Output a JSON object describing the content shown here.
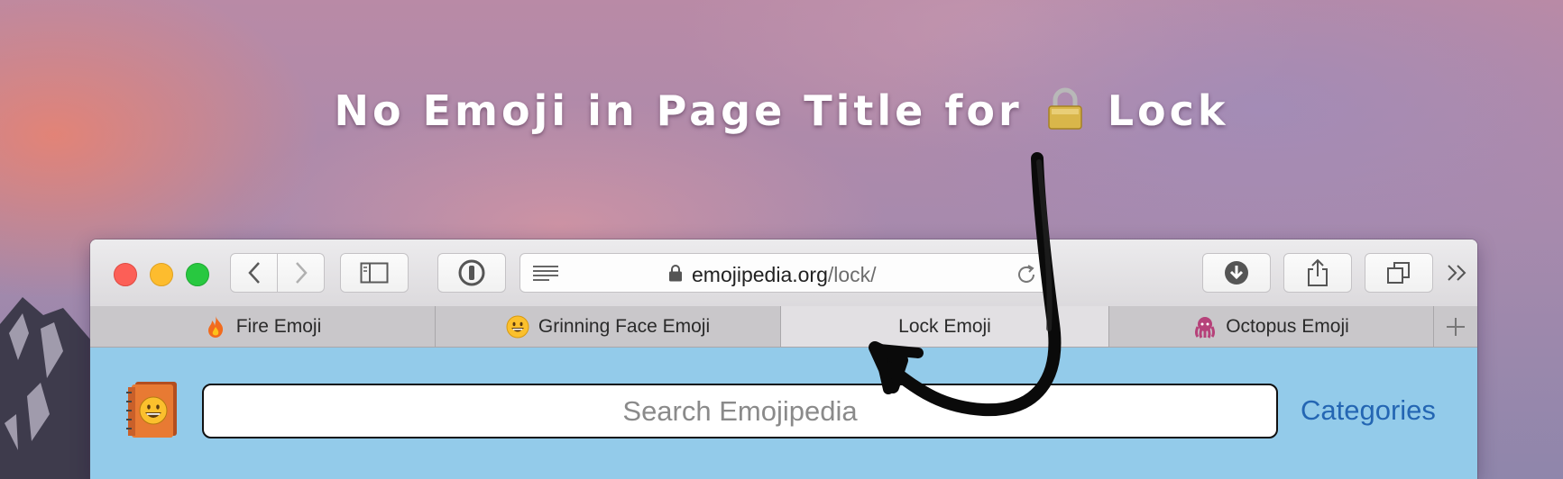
{
  "headline": {
    "before": "No Emoji in Page Title for",
    "after": "Lock"
  },
  "browser": {
    "address_bar": {
      "domain": "emojipedia.org",
      "path": "/lock/"
    },
    "tabs": [
      {
        "label": "Fire Emoji",
        "icon": "fire-icon"
      },
      {
        "label": "Grinning Face Emoji",
        "icon": "grinning-face-icon"
      },
      {
        "label": "Lock Emoji",
        "icon": "",
        "active": true
      },
      {
        "label": "Octopus Emoji",
        "icon": "octopus-icon"
      }
    ]
  },
  "site": {
    "search_placeholder": "Search Emojipedia",
    "categories_label": "Categories"
  },
  "colors": {
    "close": "#fc5f57",
    "minimize": "#fdbc2e",
    "zoom": "#28c840",
    "site_background": "#93cbea",
    "link": "#2466b3"
  }
}
